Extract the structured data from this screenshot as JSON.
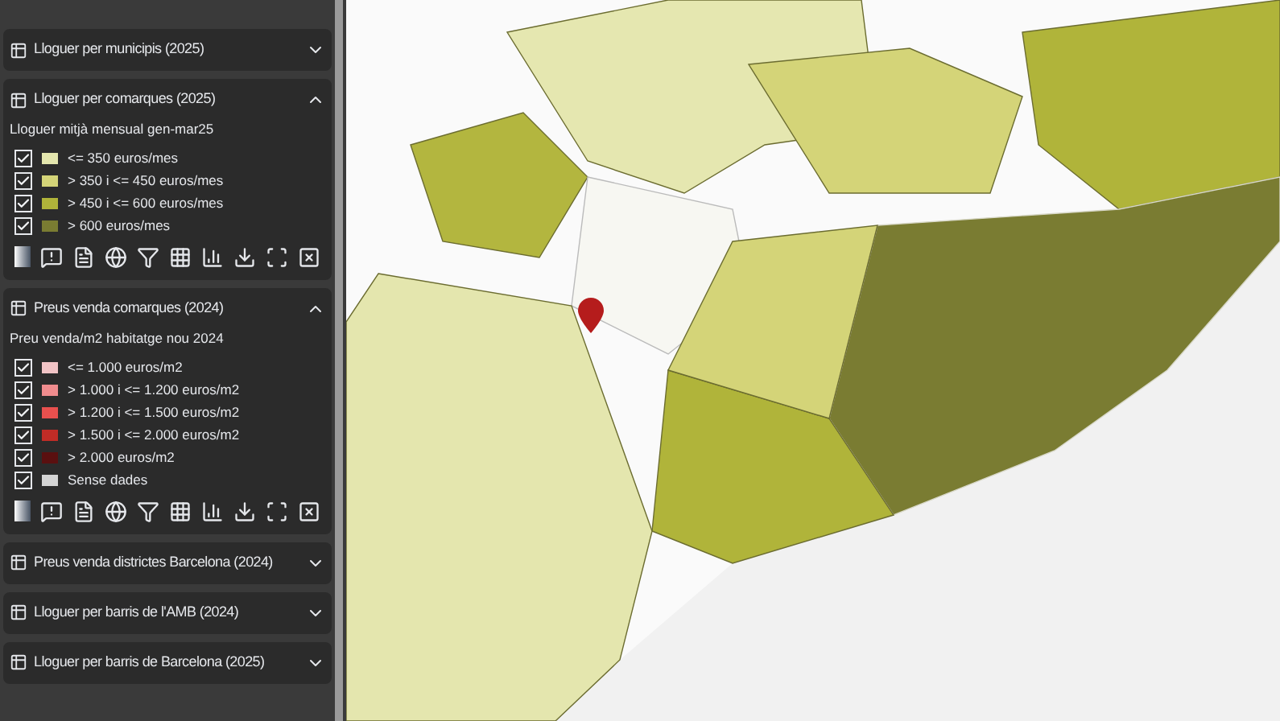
{
  "layers": [
    {
      "title": "Lloguer per municipis (2025)",
      "expanded": false
    },
    {
      "title": "Lloguer per comarques (2025)",
      "expanded": true,
      "subtitle": "Lloguer mitjà mensual gen-mar25",
      "legend": [
        {
          "label": "<= 350 euros/mes",
          "checked": true,
          "color": "#e4e6ae"
        },
        {
          "label": "> 350 i <= 450 euros/mes",
          "checked": true,
          "color": "#d4d478"
        },
        {
          "label": "> 450 i <= 600 euros/mes",
          "checked": true,
          "color": "#b0b43a"
        },
        {
          "label": "> 600 euros/mes",
          "checked": true,
          "color": "#7a7c32"
        }
      ]
    },
    {
      "title": "Preus venda comarques (2024)",
      "expanded": true,
      "subtitle": "Preu venda/m2 habitatge nou 2024",
      "legend": [
        {
          "label": "<= 1.000 euros/m2",
          "checked": true,
          "color": "#f2c4c6"
        },
        {
          "label": "> 1.000 i <= 1.200 euros/m2",
          "checked": true,
          "color": "#f08c8e"
        },
        {
          "label": "> 1.200 i <= 1.500 euros/m2",
          "checked": true,
          "color": "#e8504e"
        },
        {
          "label": "> 1.500 i <= 2.000 euros/m2",
          "checked": true,
          "color": "#c02c26"
        },
        {
          "label": "> 2.000 euros/m2",
          "checked": true,
          "color": "#5a1010"
        },
        {
          "label": "Sense dades",
          "checked": true,
          "color": "#d4d4d4"
        }
      ]
    },
    {
      "title": "Preus venda districtes Barcelona (2024)",
      "expanded": false
    },
    {
      "title": "Lloguer per barris de l'AMB (2024)",
      "expanded": false
    },
    {
      "title": "Lloguer per barris de Barcelona (2025)",
      "expanded": false
    }
  ]
}
